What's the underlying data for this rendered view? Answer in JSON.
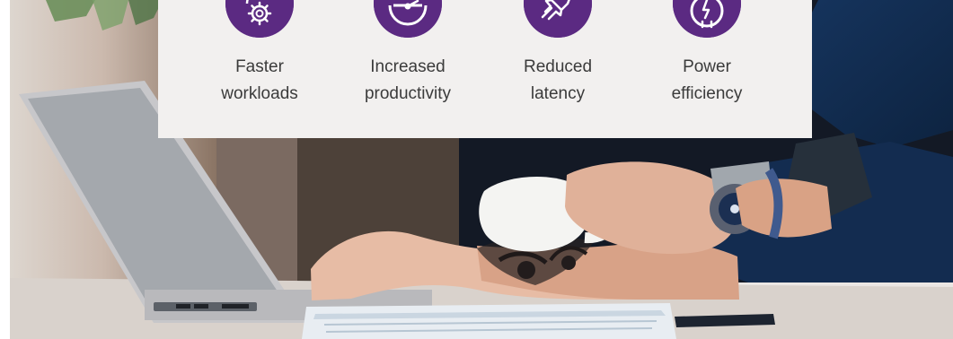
{
  "benefits": [
    {
      "icon": "gear-icon",
      "label": "Faster\nworkloads"
    },
    {
      "icon": "dashboard-icon",
      "label": "Increased\nproductivity"
    },
    {
      "icon": "rocket-icon",
      "label": "Reduced\nlatency"
    },
    {
      "icon": "power-plug-icon",
      "label": "Power\nefficiency"
    }
  ],
  "colors": {
    "accent": "#5b2a82",
    "panel": "#f2f0ef",
    "text": "#3b3b3b"
  }
}
